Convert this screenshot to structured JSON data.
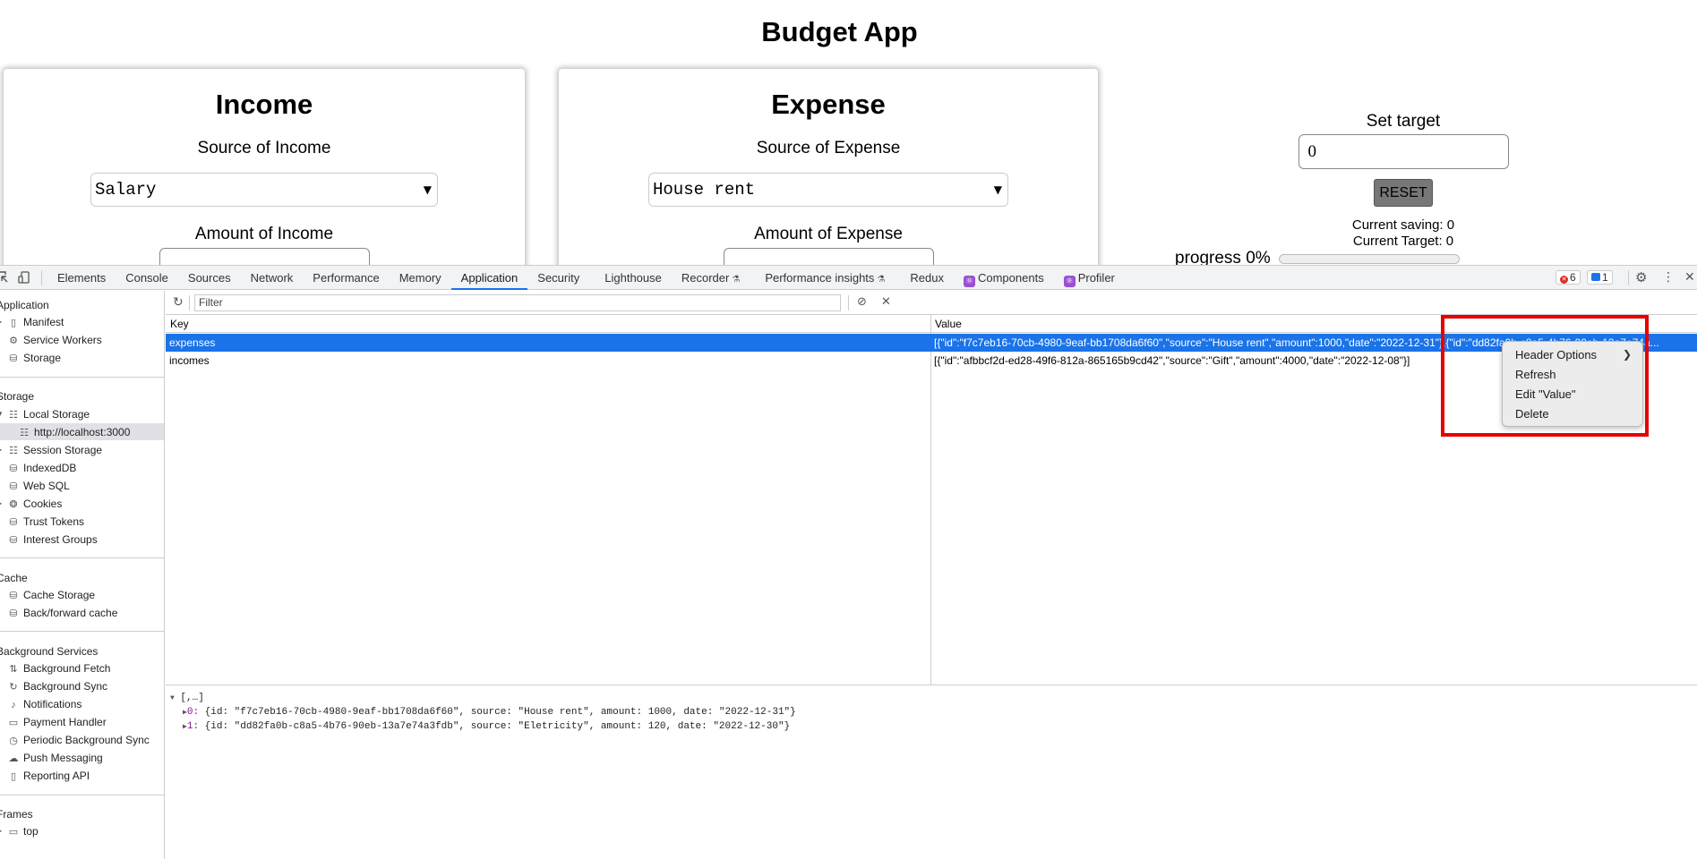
{
  "app": {
    "title": "Budget App",
    "income": {
      "heading": "Income",
      "source_label": "Source of Income",
      "source_value": "Salary",
      "amount_label": "Amount of Income"
    },
    "expense": {
      "heading": "Expense",
      "source_label": "Source of Expense",
      "source_value": "House rent",
      "amount_label": "Amount of Expense"
    },
    "target": {
      "label": "Set target",
      "input_value": "0",
      "reset_label": "RESET",
      "current_saving": "Current saving: 0",
      "current_target": "Current Target: 0",
      "progress_label": "progress 0%",
      "progress_value": 0
    }
  },
  "devtools": {
    "tabs": [
      {
        "label": "Elements"
      },
      {
        "label": "Console"
      },
      {
        "label": "Sources"
      },
      {
        "label": "Network"
      },
      {
        "label": "Performance"
      },
      {
        "label": "Memory"
      },
      {
        "label": "Application"
      },
      {
        "label": "Security"
      },
      {
        "label": "Lighthouse"
      },
      {
        "label": "Recorder"
      },
      {
        "label": "Performance insights"
      },
      {
        "label": "Redux"
      },
      {
        "label": "Components"
      },
      {
        "label": "Profiler"
      }
    ],
    "error_count": "6",
    "message_count": "1",
    "sidebar": {
      "sections": [
        {
          "label": "Application"
        },
        {
          "label": "Storage"
        },
        {
          "label": "Cache"
        },
        {
          "label": "Background Services"
        },
        {
          "label": "Frames"
        }
      ],
      "application_items": [
        {
          "label": "Manifest",
          "icon": "file-icon"
        },
        {
          "label": "Service Workers",
          "icon": "gear-icon"
        },
        {
          "label": "Storage",
          "icon": "database-icon"
        }
      ],
      "storage_items": [
        {
          "label": "Local Storage",
          "icon": "grid-icon"
        },
        {
          "label": "http://localhost:3000",
          "icon": "grid-icon"
        },
        {
          "label": "Session Storage",
          "icon": "grid-icon"
        },
        {
          "label": "IndexedDB",
          "icon": "database-icon"
        },
        {
          "label": "Web SQL",
          "icon": "database-icon"
        },
        {
          "label": "Cookies",
          "icon": "cookie-icon"
        },
        {
          "label": "Trust Tokens",
          "icon": "database-icon"
        },
        {
          "label": "Interest Groups",
          "icon": "database-icon"
        }
      ],
      "cache_items": [
        {
          "label": "Cache Storage",
          "icon": "database-icon"
        },
        {
          "label": "Back/forward cache",
          "icon": "database-icon"
        }
      ],
      "background_items": [
        {
          "label": "Background Fetch",
          "icon": "arrows-updown-icon"
        },
        {
          "label": "Background Sync",
          "icon": "sync-icon"
        },
        {
          "label": "Notifications",
          "icon": "bell-icon"
        },
        {
          "label": "Payment Handler",
          "icon": "card-icon"
        },
        {
          "label": "Periodic Background Sync",
          "icon": "clock-icon"
        },
        {
          "label": "Push Messaging",
          "icon": "cloud-icon"
        },
        {
          "label": "Reporting API",
          "icon": "file-icon"
        }
      ],
      "frames_items": [
        {
          "label": "top",
          "icon": "frame-icon"
        }
      ]
    },
    "storage_view": {
      "filter_placeholder": "Filter",
      "columns": {
        "key": "Key",
        "value": "Value"
      },
      "rows": [
        {
          "key": "expenses",
          "value": "[{\"id\":\"f7c7eb16-70cb-4980-9eaf-bb1708da6f60\",\"source\":\"House rent\",\"amount\":1000,\"date\":\"2022-12-31\"},{\"id\":\"dd82fa0b-c8a5-4b76-90eb-13a7e74a..."
        },
        {
          "key": "incomes",
          "value": "[{\"id\":\"afbbcf2d-ed28-49f6-812a-865165b9cd42\",\"source\":\"Gift\",\"amount\":4000,\"date\":\"2022-12-08\"}]"
        }
      ],
      "preview": {
        "root": "[,…]",
        "items": [
          {
            "index": "0",
            "text": "{id: \"f7c7eb16-70cb-4980-9eaf-bb1708da6f60\", source: \"House rent\", amount: 1000, date: \"2022-12-31\"}"
          },
          {
            "index": "1",
            "text": "{id: \"dd82fa0b-c8a5-4b76-90eb-13a7e74a3fdb\", source: \"Eletricity\", amount: 120, date: \"2022-12-30\"}"
          }
        ]
      }
    },
    "context_menu": {
      "items": [
        {
          "label": "Header Options"
        },
        {
          "label": "Refresh"
        },
        {
          "label": "Edit \"Value\""
        },
        {
          "label": "Delete"
        }
      ]
    },
    "highlight_color": "#e60000",
    "accent_color": "#1a73e8"
  }
}
